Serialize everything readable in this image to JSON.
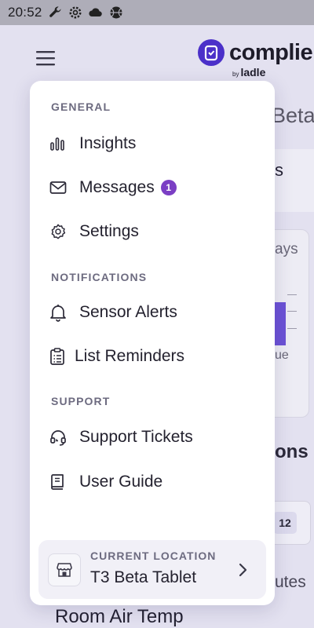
{
  "status_bar": {
    "time": "20:52",
    "icons": [
      "wrench-icon",
      "gear-icon",
      "cloud-icon",
      "ball-icon"
    ]
  },
  "app": {
    "brand": "complie",
    "brand_sub_by": "by",
    "brand_sub": "ladle",
    "background_fragments": {
      "title_fragment": "Beta",
      "card1_fragment": "s",
      "card2_fragment": "ays",
      "card2_bottom_fragment": "ue",
      "section_fragment": "ons",
      "count_fragment": "12",
      "minutes_fragment": "utes",
      "room_label": "Room Air Temp"
    }
  },
  "drawer": {
    "sections": [
      {
        "title": "GENERAL",
        "items": [
          {
            "label": "Insights",
            "icon": "bar-chart-icon"
          },
          {
            "label": "Messages",
            "icon": "mail-icon",
            "badge": "1"
          },
          {
            "label": "Settings",
            "icon": "gear-icon"
          }
        ]
      },
      {
        "title": "NOTIFICATIONS",
        "items": [
          {
            "label": "Sensor Alerts",
            "icon": "bell-icon"
          },
          {
            "label": "List Reminders",
            "icon": "clipboard-list-icon"
          }
        ]
      },
      {
        "title": "SUPPORT",
        "items": [
          {
            "label": "Support Tickets",
            "icon": "headset-icon"
          },
          {
            "label": "User Guide",
            "icon": "book-icon"
          }
        ]
      }
    ],
    "location": {
      "caption": "CURRENT LOCATION",
      "value": "T3 Beta Tablet",
      "icon": "store-icon"
    }
  },
  "colors": {
    "accent": "#4b30c9",
    "badge": "#7b3fc4",
    "text": "#24222f",
    "muted": "#6d6b80"
  }
}
